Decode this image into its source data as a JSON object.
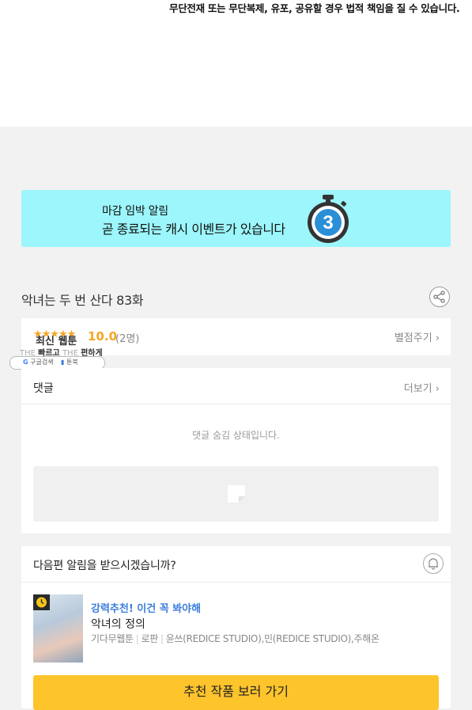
{
  "notice": {
    "copyright_text": "무단전재 또는 무단복제, 유포, 공유할 경우 법적 책임을 질 수 있습니다."
  },
  "banner": {
    "line1": "마감 임박 알림",
    "line2": "곧 종료되는 캐시 이벤트가 있습니다",
    "timer_number": "3",
    "icon": "stopwatch-icon",
    "background": "#9cf6fb"
  },
  "episode": {
    "title": "악녀는 두 번 산다 83화",
    "share_icon": "share-icon"
  },
  "rating": {
    "stars": "★★★★★",
    "score": "10.0",
    "count": "(2명)",
    "rate_button": "별점주기",
    "accent": "#f5a623"
  },
  "overlay_ad": {
    "title": "최신 웹툰",
    "tag_the1": "THE",
    "tag_fast": "빠르고",
    "tag_the2": "THE",
    "tag_easy": "편하게",
    "google_label": "구글검색",
    "booktoon_label": "툰북"
  },
  "comments": {
    "header": "댓글",
    "more": "더보기",
    "hidden_message": "댓글 숨김 상태입니다."
  },
  "next_notice": {
    "question": "다음편 알림을 받으시겠습니까?",
    "bell_icon": "bell-icon"
  },
  "recommendation": {
    "label": "강력추천! 이건 꼭 봐야해",
    "title": "악녀의 정의",
    "genre_1": "기다무웹툰",
    "genre_2": "로판",
    "authors": "윤쓰(REDICE STUDIO),민(REDICE STUDIO),주해온",
    "button_label": "추천 작품 보러 가기",
    "button_color": "#fec42c"
  }
}
